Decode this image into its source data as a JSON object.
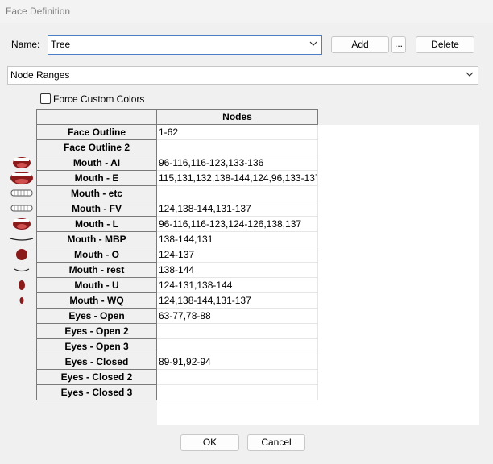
{
  "window": {
    "title": "Face Definition"
  },
  "name_field": {
    "label": "Name:",
    "value": "Tree"
  },
  "buttons": {
    "add": "Add",
    "more": "...",
    "delete": "Delete",
    "ok": "OK",
    "cancel": "Cancel"
  },
  "view_select": {
    "value": "Node Ranges"
  },
  "force_custom_colors": {
    "label": "Force Custom Colors",
    "checked": false
  },
  "grid": {
    "column_header": "Nodes",
    "rows": [
      {
        "label": "Face Outline",
        "nodes": "1-62",
        "icon": ""
      },
      {
        "label": "Face Outline 2",
        "nodes": "",
        "icon": ""
      },
      {
        "label": "Mouth - AI",
        "nodes": "96-116,116-123,133-136",
        "icon": "mouth-open-teeth-icon"
      },
      {
        "label": "Mouth - E",
        "nodes": "115,131,132,138-144,124,96,133-137",
        "icon": "mouth-wide-teeth-icon"
      },
      {
        "label": "Mouth - etc",
        "nodes": "",
        "icon": "mouth-teeth-icon"
      },
      {
        "label": "Mouth - FV",
        "nodes": "124,138-144,131-137",
        "icon": "mouth-teeth-icon"
      },
      {
        "label": "Mouth - L",
        "nodes": "96-116,116-123,124-126,138,137",
        "icon": "mouth-open-teeth-icon"
      },
      {
        "label": "Mouth - MBP",
        "nodes": "138-144,131",
        "icon": "mouth-closed-line-icon"
      },
      {
        "label": "Mouth - O",
        "nodes": "124-137",
        "icon": "mouth-round-icon"
      },
      {
        "label": "Mouth - rest",
        "nodes": "138-144",
        "icon": "mouth-rest-icon"
      },
      {
        "label": "Mouth - U",
        "nodes": "124-131,138-144",
        "icon": "mouth-small-round-icon"
      },
      {
        "label": "Mouth - WQ",
        "nodes": "124,138-144,131-137",
        "icon": "mouth-tiny-round-icon"
      },
      {
        "label": "Eyes - Open",
        "nodes": "63-77,78-88",
        "icon": ""
      },
      {
        "label": "Eyes - Open 2",
        "nodes": "",
        "icon": ""
      },
      {
        "label": "Eyes - Open 3",
        "nodes": "",
        "icon": ""
      },
      {
        "label": "Eyes - Closed",
        "nodes": "89-91,92-94",
        "icon": ""
      },
      {
        "label": "Eyes - Closed 2",
        "nodes": "",
        "icon": ""
      },
      {
        "label": "Eyes - Closed 3",
        "nodes": "",
        "icon": ""
      }
    ]
  }
}
